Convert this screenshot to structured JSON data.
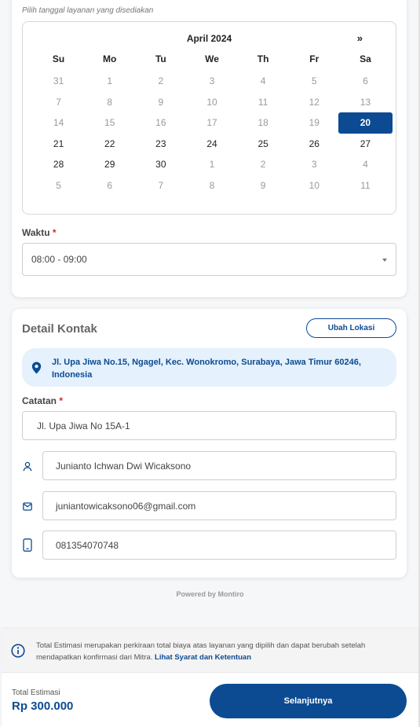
{
  "schedule": {
    "hint": "Pilih tanggal layanan yang disediakan",
    "calendar": {
      "month_label": "April 2024",
      "next_label": "»",
      "weekdays": [
        "Su",
        "Mo",
        "Tu",
        "We",
        "Th",
        "Fr",
        "Sa"
      ],
      "weeks": [
        [
          "31",
          "1",
          "2",
          "3",
          "4",
          "5",
          "6"
        ],
        [
          "7",
          "8",
          "9",
          "10",
          "11",
          "12",
          "13"
        ],
        [
          "14",
          "15",
          "16",
          "17",
          "18",
          "19",
          "20"
        ],
        [
          "21",
          "22",
          "23",
          "24",
          "25",
          "26",
          "27"
        ],
        [
          "28",
          "29",
          "30",
          "1",
          "2",
          "3",
          "4"
        ],
        [
          "5",
          "6",
          "7",
          "8",
          "9",
          "10",
          "11"
        ]
      ],
      "selected_date": "20"
    },
    "time_label": "Waktu",
    "required_mark": "*",
    "time_value": "08:00 - 09:00"
  },
  "contact": {
    "title": "Detail Kontak",
    "change_location_label": "Ubah Lokasi",
    "address": "Jl. Upa Jiwa No.15, Ngagel, Kec. Wonokromo, Surabaya, Jawa Timur 60246, Indonesia",
    "notes_label": "Catatan",
    "required_mark": "*",
    "notes_value": "Jl. Upa Jiwa No 15A-1",
    "name_value": "Junianto Ichwan Dwi Wicaksono",
    "email_value": "juniantowicaksono06@gmail.com",
    "phone_value": "081354070748"
  },
  "powered_by": "Powered by Montiro",
  "footer": {
    "info_text": "Total Estimasi merupakan perkiraan total biaya atas layanan yang dipilih dan dapat berubah setelah mendapatkan konfirmasi dari Mitra.",
    "info_link": "Lihat Syarat dan Ketentuan",
    "total_label": "Total Estimasi",
    "total_value": "Rp 300.000",
    "next_button": "Selanjutnya"
  },
  "colors": {
    "primary": "#0c4b92",
    "address_bg": "#e5f1fd",
    "required": "#d6272b"
  },
  "icons": {
    "address": "location-pin-icon",
    "name": "user-icon",
    "email": "mail-icon",
    "phone": "phone-icon",
    "info": "info-icon",
    "dropdown": "chevron-down-icon"
  }
}
